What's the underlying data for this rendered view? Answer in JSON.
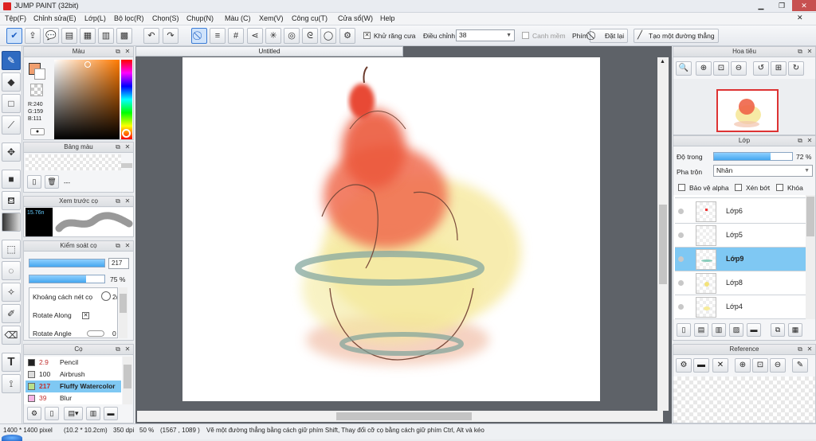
{
  "app": {
    "title": "JUMP PAINT (32bit)"
  },
  "menu": [
    "Tệp(F)",
    "Chỉnh sửa(E)",
    "Lớp(L)",
    "Bộ lọc(R)",
    "Chọn(S)",
    "Chụp(N)",
    "Màu (C)",
    "Xem(V)",
    "Công cụ(T)",
    "Cửa sổ(W)",
    "Help"
  ],
  "toolbar": {
    "antialias_label": "Khử răng cưa",
    "adjust_label": "Điều chỉnh",
    "adjust_value": "38",
    "smooth_label": "Canh mềm",
    "key_label": "Phím",
    "reset_label": "Đặt lại",
    "straight_line_label": "Tạo một đường thẳng"
  },
  "color_panel": {
    "title": "Màu",
    "r": "R:240",
    "g": "G:159",
    "b": "B:111",
    "primary_color": "#f09f6f"
  },
  "palette_panel": {
    "title": "Bảng màu",
    "value": "---"
  },
  "brush_preview_panel": {
    "title": "Xem trước cọ",
    "size": "15.76n"
  },
  "brush_control_panel": {
    "title": "Kiểm soát cọ",
    "size_value": "217",
    "opacity_value": "75 %",
    "opacity_fraction": 0.75,
    "spacing_label": "Khoảng cách nét cọ",
    "spacing_value": "2(",
    "rotate_along_label": "Rotate Along",
    "rotate_angle_label": "Rotate Angle",
    "rotate_angle_value": "0"
  },
  "brush_list_panel": {
    "title": "Cọ",
    "items": [
      {
        "size": "2.9",
        "name": "Pencil",
        "color": "#222222"
      },
      {
        "size": "100",
        "name": "Airbrush",
        "color": "#dddddd"
      },
      {
        "size": "217",
        "name": "Fluffy Watercolor",
        "color": "#b8e08a"
      },
      {
        "size": "39",
        "name": "Blur",
        "color": "#f7b4e6"
      }
    ]
  },
  "document": {
    "tab_title": "Untitled"
  },
  "navigator_panel": {
    "title": "Hoa tiêu"
  },
  "layer_panel": {
    "title": "Lớp",
    "opacity_label": "Độ trong",
    "opacity_value": "72 %",
    "opacity_fraction": 0.72,
    "blend_label": "Pha trộn",
    "blend_value": "Nhân",
    "protect_alpha_label": "Bảo vệ alpha",
    "clip_label": "Xén bớt",
    "lock_label": "Khóa",
    "layers": [
      {
        "name": "Lớp6"
      },
      {
        "name": "Lớp5"
      },
      {
        "name": "Lớp9"
      },
      {
        "name": "Lớp8"
      },
      {
        "name": "Lớp4"
      }
    ]
  },
  "reference_panel": {
    "title": "Reference"
  },
  "status": {
    "pixel_size": "1400 * 1400 pixel",
    "cm_size": "(10.2 * 10.2cm)",
    "dpi": "350 dpi",
    "zoom": "50 %",
    "coords": "(1567 , 1089 )",
    "hint": "Vẽ một đường thẳng bằng cách giữ phím Shift, Thay đổi cỡ cọ bằng cách giữ phím Ctrl, Alt và kéo"
  },
  "colors": {
    "accent": "#3a7bd5",
    "selection": "#7fc8f3",
    "canvas_bg": "#5e6268"
  }
}
